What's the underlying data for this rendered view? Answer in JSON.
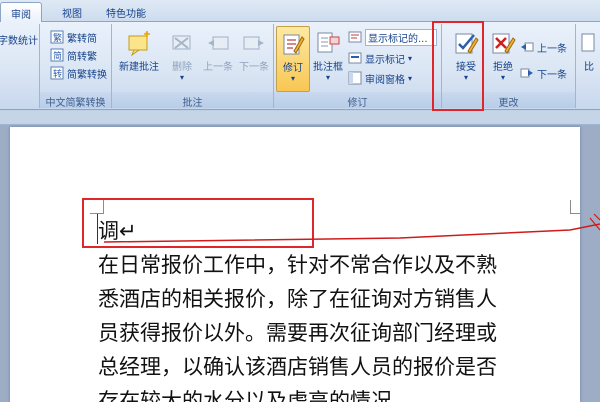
{
  "tabs": [
    {
      "label": "审阅",
      "active": true
    },
    {
      "label": "视图",
      "active": false
    },
    {
      "label": "特色功能",
      "active": false
    }
  ],
  "groups": {
    "proofing": {
      "partial_label": "字数统计"
    },
    "chinese": {
      "label": "中文简繁转换",
      "buttons": [
        "繁转简",
        "简转繁",
        "简繁转换"
      ]
    },
    "comments": {
      "label": "批注",
      "buttons": [
        "新建批注",
        "删除",
        "上一条",
        "下一条"
      ]
    },
    "tracking": {
      "label": "修订",
      "track_changes": "修订",
      "balloons": "批注框",
      "markup_dropdown": "显示标记的...",
      "show_markup": "显示标记",
      "reviewing_pane": "审阅窗格"
    },
    "changes": {
      "label": "更改",
      "accept": "接受",
      "reject": "拒绝",
      "previous": "上一条",
      "next": "下一条"
    },
    "compare": {
      "partial_label": "比"
    }
  },
  "document": {
    "lines": [
      "调↵",
      "在日常报价工作中，针对不常合作以及不熟",
      "悉酒店的相关报价，除了在征询对方销售人",
      "员获得报价以外。需要再次征询部门经理或",
      "总经理，以确认该酒店销售人员的报价是否",
      "存在较大的水分以及虚高的情况"
    ]
  },
  "colors": {
    "highlight": "#e0252b",
    "ribbon": "#dbe6f4",
    "accent_text": "#15428b"
  }
}
